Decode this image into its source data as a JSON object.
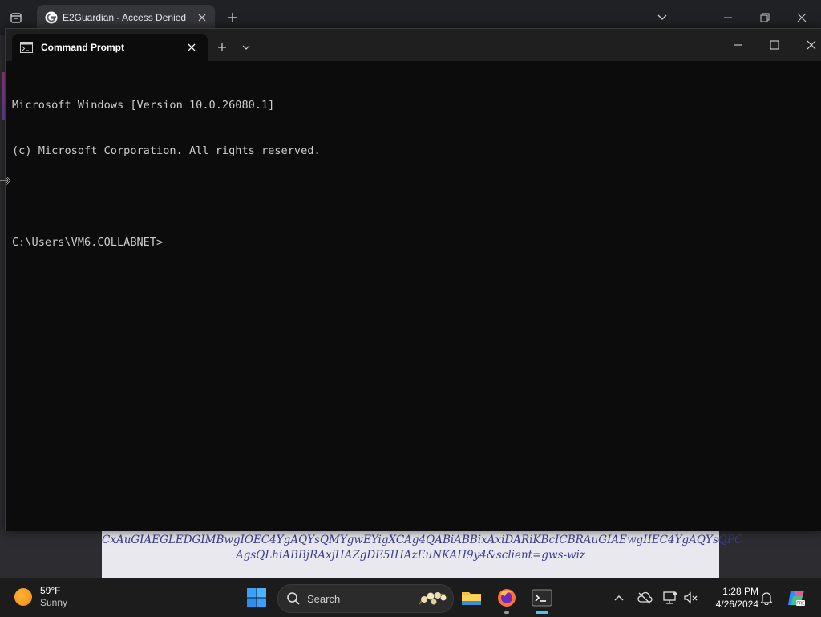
{
  "browser": {
    "tab_title": "E2Guardian - Access Denied",
    "page_lines": [
      "CxAuGIAEGLEDGIMBwgIOEC4YgAQYsQMYgwEYigXCAg4QABiABBixAxiDARiKBcICBRAuGIAEwgIIEC4YgAQYsQPC",
      "AgsQLhiABBjRAxjHAZgDE5IHAzEuNKAH9y4&sclient=gws-wiz"
    ]
  },
  "terminal": {
    "tab_title": "Command Prompt",
    "lines": [
      "Microsoft Windows [Version 10.0.26080.1]",
      "(c) Microsoft Corporation. All rights reserved.",
      "",
      "C:\\Users\\VM6.COLLABNET>"
    ]
  },
  "taskbar": {
    "weather_temp": "59°F",
    "weather_condition": "Sunny",
    "search_label": "Search",
    "time": "1:28 PM",
    "date": "4/26/2024",
    "pinned_apps": [
      "file-explorer",
      "firefox",
      "terminal"
    ]
  },
  "colors": {
    "terminal_bg": "#0c0c0c",
    "terminal_text": "#cccccc",
    "taskbar_bg": "#1c1c1c",
    "accent_blue": "#4cc2ff",
    "windows_logo": "#3aa0ff"
  },
  "icons": {
    "browser": [
      "tab-search-icon",
      "google-favicon-icon",
      "close-icon",
      "plus-icon",
      "chevron-down-icon",
      "minimize-icon",
      "restore-icon",
      "close-icon"
    ],
    "terminal": [
      "cmd-icon",
      "close-icon",
      "plus-icon",
      "chevron-down-icon",
      "minimize-icon",
      "maximize-icon",
      "close-icon"
    ],
    "tray": [
      "chevron-up-icon",
      "cloud-offline-icon",
      "display-icon",
      "speaker-icon",
      "bell-icon",
      "copilot-icon"
    ]
  }
}
